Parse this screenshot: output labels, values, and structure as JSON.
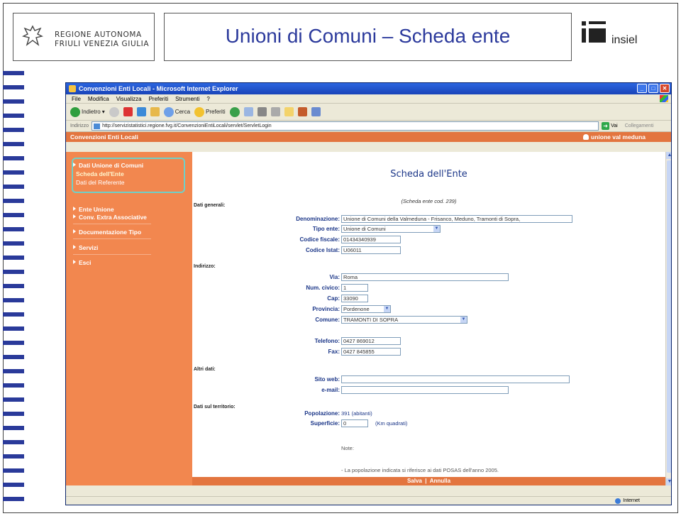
{
  "slide": {
    "title": "Unioni di Comuni – Scheda ente",
    "region_logo_line1": "REGIONE AUTONOMA",
    "region_logo_line2": "FRIULI VENEZIA GIULIA",
    "partner_logo": "insiel"
  },
  "browser": {
    "window_title": "Convenzioni Enti Locali - Microsoft Internet Explorer",
    "menu": [
      "File",
      "Modifica",
      "Visualizza",
      "Preferiti",
      "Strumenti",
      "?"
    ],
    "toolbar": {
      "back": "Indietro",
      "search": "Cerca",
      "favorites": "Preferiti"
    },
    "address_label": "Indirizzo",
    "address_value": "http://servizistatistici.regione.fvg.it/ConvenzioniEntiLocali/servlet/ServletLogin",
    "go_label": "Vai",
    "links_label": "Collegamenti",
    "status_zone": "Internet"
  },
  "app": {
    "header_title": "Convenzioni Enti Locali",
    "user_name": "unione val meduna",
    "sidebar": {
      "group1": "Dati Unione di Comuni",
      "group1_items": [
        "Scheda dell'Ente",
        "Dati del Referente"
      ],
      "items": [
        "Ente Unione",
        "Conv. Extra Associative",
        "Documentazione Tipo",
        "Servizi",
        "Esci"
      ]
    },
    "form": {
      "title": "Scheda dell'Ente",
      "subtitle": "(Scheda ente cod. 239)",
      "sections": {
        "general": "Dati generali:",
        "address": "Indirizzo:",
        "other": "Altri dati:",
        "territory": "Dati sul territorio:"
      },
      "labels": {
        "denominazione": "Denominazione:",
        "tipo_ente": "Tipo ente:",
        "codice_fiscale": "Codice fiscale:",
        "codice_istat": "Codice Istat:",
        "via": "Via:",
        "num_civico": "Num. civico:",
        "cap": "Cap:",
        "provincia": "Provincia:",
        "comune": "Comune:",
        "telefono": "Telefono:",
        "fax": "Fax:",
        "sito_web": "Sito web:",
        "email": "e-mail:",
        "popolazione": "Popolazione:",
        "superficie": "Superficie:"
      },
      "values": {
        "denominazione": "Unione di Comuni della Valmeduna - Frisanco, Meduno, Tramonti di Sopra,",
        "tipo_ente": "Unione di Comuni",
        "codice_fiscale": "01434340939",
        "codice_istat": "U06011",
        "via": "Roma",
        "num_civico": "1",
        "cap": "33090",
        "provincia": "Pordenone",
        "comune": "TRAMONTI DI SOPRA",
        "telefono": "0427 869012",
        "fax": "0427 845855",
        "sito_web": "",
        "email": "",
        "popolazione": "391  (abitanti)",
        "superficie": "0",
        "superficie_unit": "(Km quadrati)"
      },
      "note_label": "Note:",
      "note_text": "- La popolazione indicata si riferisce ai dati POSAS dell'anno 2005.",
      "save_label": "Salva",
      "separator": "|",
      "cancel_label": "Annulla"
    }
  },
  "colors": {
    "accent_orange": "#e3753f",
    "sidebar_orange": "#f2874f",
    "title_blue": "#2c3a9c",
    "highlight_teal": "#6ed1c9"
  }
}
